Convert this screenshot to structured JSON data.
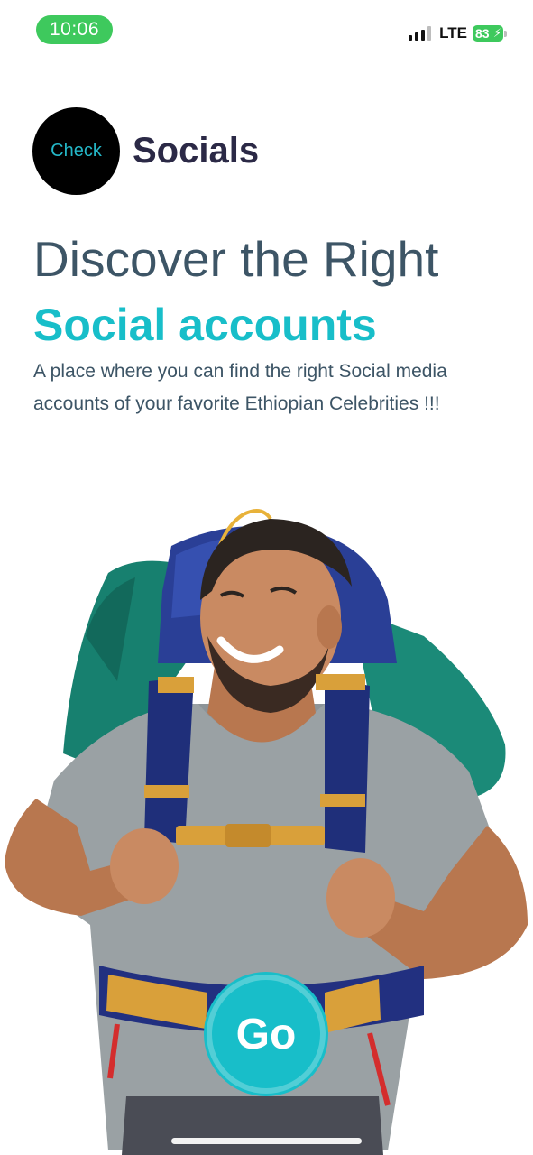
{
  "status_bar": {
    "time": "10:06",
    "network": "LTE",
    "battery": "83"
  },
  "logo": {
    "circle_text": "Check",
    "text": "Socials"
  },
  "headline": "Discover the Right",
  "subheadline": "Social accounts",
  "description": "A place where you can find the right Social media accounts of your favorite Ethiopian Celebrities !!!",
  "cta": {
    "label": "Go"
  },
  "colors": {
    "accent": "#18bec9",
    "headline": "#3d5566",
    "logo_text": "#2b2946",
    "status_green": "#3ec95d"
  },
  "icons": {
    "signal": "signal-icon",
    "battery": "battery-icon"
  }
}
